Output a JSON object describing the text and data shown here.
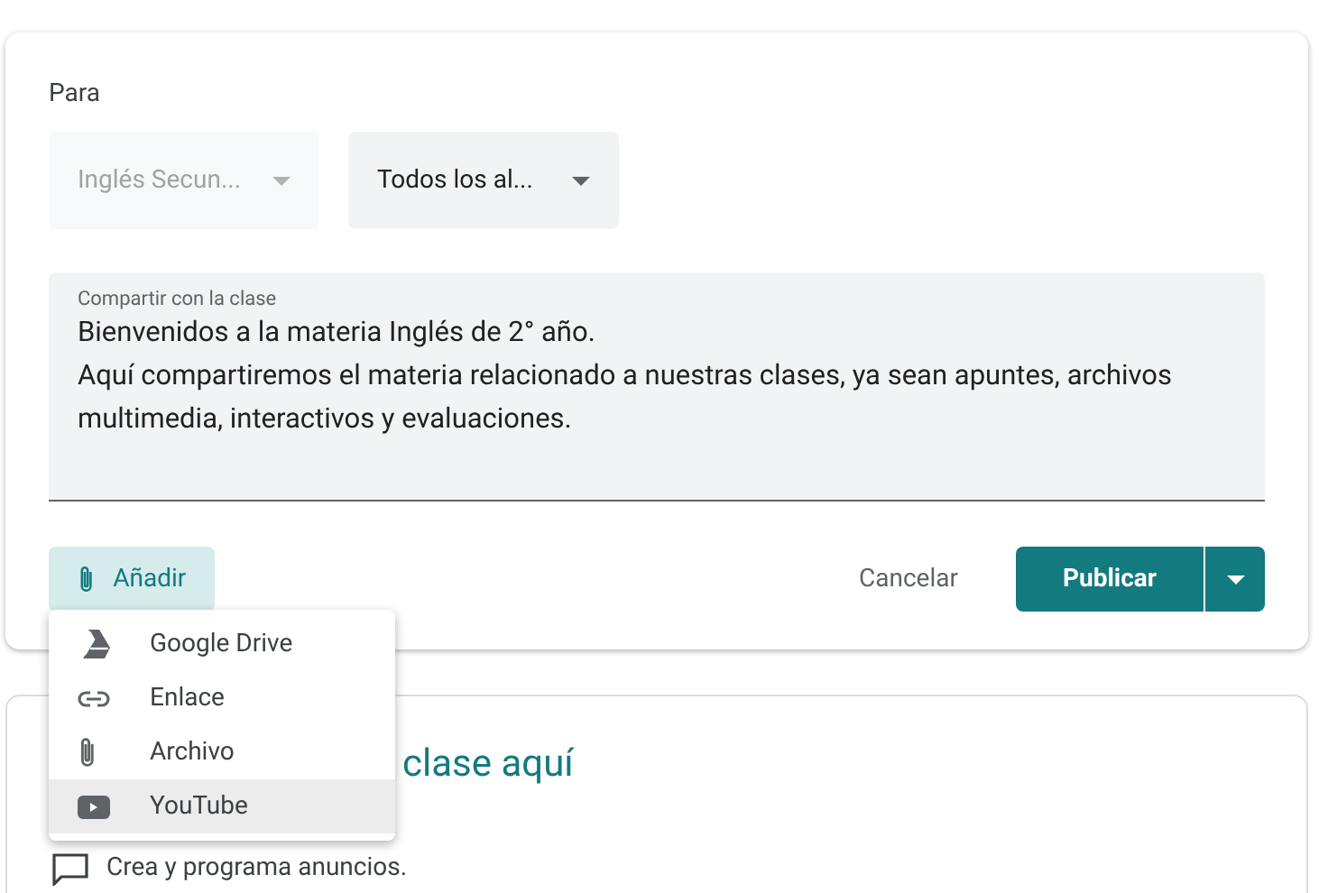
{
  "post_card": {
    "audience_label": "Para",
    "dropdowns": [
      {
        "value": "Inglés Secun...",
        "disabled": true
      },
      {
        "value": "Todos los al...",
        "disabled": false
      }
    ],
    "share_field": {
      "label": "Compartir con la clase",
      "value": "Bienvenidos a la materia Inglés de 2° año.\nAquí compartiremos el materia relacionado a nuestras clases, ya sean apuntes, archivos multimedia, interactivos y evaluaciones."
    },
    "add_button": "Añadir",
    "cancel_button": "Cancelar",
    "publish_button": "Publicar"
  },
  "add_menu": [
    {
      "kind": "drive",
      "label": "Google Drive",
      "highlighted": false
    },
    {
      "kind": "link",
      "label": "Enlace",
      "highlighted": false
    },
    {
      "kind": "file",
      "label": "Archivo",
      "highlighted": false
    },
    {
      "kind": "youtube",
      "label": "YouTube",
      "highlighted": true
    }
  ],
  "info_card": {
    "title": "clase aquí",
    "subtitle": "Crea y programa anuncios."
  }
}
